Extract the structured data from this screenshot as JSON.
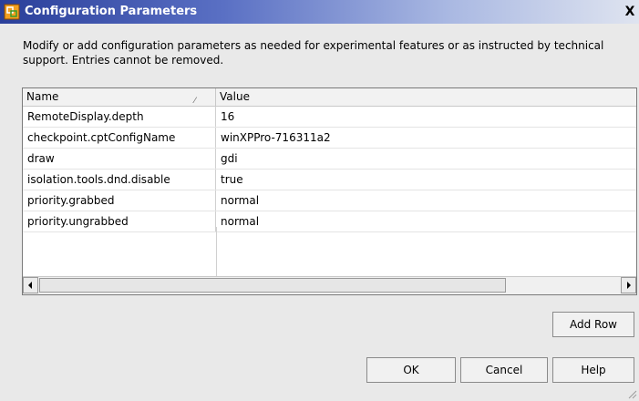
{
  "window": {
    "title": "Configuration Parameters",
    "close_label": "X"
  },
  "description": "Modify or add configuration parameters as needed for experimental features or as instructed by technical support. Entries cannot be removed.",
  "table": {
    "columns": [
      "Name",
      "Value"
    ],
    "rows": [
      {
        "name": "RemoteDisplay.depth",
        "value": "16"
      },
      {
        "name": "checkpoint.cptConfigName",
        "value": "winXPPro-716311a2"
      },
      {
        "name": "draw",
        "value": "gdi"
      },
      {
        "name": "isolation.tools.dnd.disable",
        "value": "true"
      },
      {
        "name": "priority.grabbed",
        "value": "normal"
      },
      {
        "name": "priority.ungrabbed",
        "value": "normal"
      }
    ]
  },
  "buttons": {
    "add_row": "Add Row",
    "ok": "OK",
    "cancel": "Cancel",
    "help": "Help"
  }
}
